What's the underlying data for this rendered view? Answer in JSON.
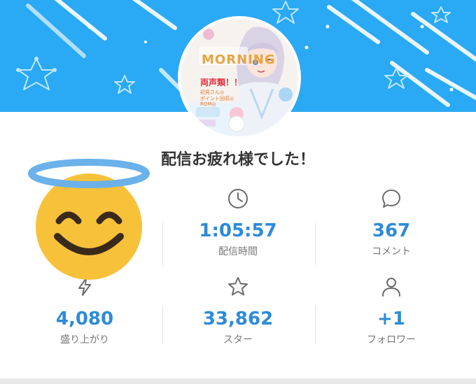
{
  "message": "配信お疲れ様でした！",
  "thumbnail": {
    "banner": "MORNING",
    "title": "両声類！！",
    "lines": [
      "初見さん◎",
      "ポイント回収◎",
      "ROM◎"
    ]
  },
  "stats": [
    {
      "icon": "clock-icon",
      "value": "1:05:57",
      "label": "配信時間"
    },
    {
      "icon": "comment-bubble-icon",
      "value": "367",
      "label": "コメント"
    },
    {
      "icon": "lightning-icon",
      "value": "4,080",
      "label": "盛り上がり"
    },
    {
      "icon": "star-icon",
      "value": "33,862",
      "label": "スター"
    },
    {
      "icon": "person-icon",
      "value": "+1",
      "label": "フォロワー"
    }
  ],
  "colors": {
    "header": "#2aa9f4",
    "value": "#2e8bd8",
    "label": "#777777",
    "emoji": "#f7c23a",
    "halo": "#6bb1ea"
  }
}
